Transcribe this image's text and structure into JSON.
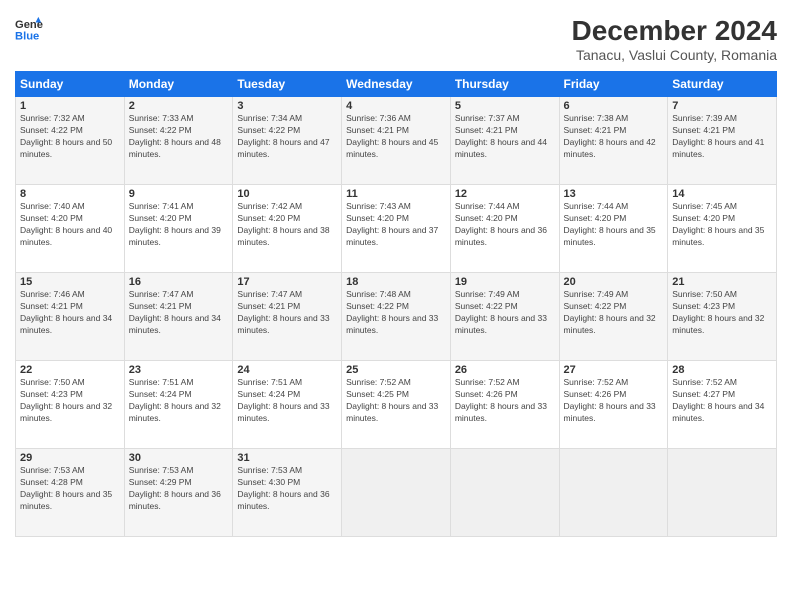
{
  "header": {
    "logo_line1": "General",
    "logo_line2": "Blue",
    "title": "December 2024",
    "subtitle": "Tanacu, Vaslui County, Romania"
  },
  "days_of_week": [
    "Sunday",
    "Monday",
    "Tuesday",
    "Wednesday",
    "Thursday",
    "Friday",
    "Saturday"
  ],
  "weeks": [
    [
      {
        "day": "1",
        "sunrise": "7:32 AM",
        "sunset": "4:22 PM",
        "daylight": "8 hours and 50 minutes."
      },
      {
        "day": "2",
        "sunrise": "7:33 AM",
        "sunset": "4:22 PM",
        "daylight": "8 hours and 48 minutes."
      },
      {
        "day": "3",
        "sunrise": "7:34 AM",
        "sunset": "4:22 PM",
        "daylight": "8 hours and 47 minutes."
      },
      {
        "day": "4",
        "sunrise": "7:36 AM",
        "sunset": "4:21 PM",
        "daylight": "8 hours and 45 minutes."
      },
      {
        "day": "5",
        "sunrise": "7:37 AM",
        "sunset": "4:21 PM",
        "daylight": "8 hours and 44 minutes."
      },
      {
        "day": "6",
        "sunrise": "7:38 AM",
        "sunset": "4:21 PM",
        "daylight": "8 hours and 42 minutes."
      },
      {
        "day": "7",
        "sunrise": "7:39 AM",
        "sunset": "4:21 PM",
        "daylight": "8 hours and 41 minutes."
      }
    ],
    [
      {
        "day": "8",
        "sunrise": "7:40 AM",
        "sunset": "4:20 PM",
        "daylight": "8 hours and 40 minutes."
      },
      {
        "day": "9",
        "sunrise": "7:41 AM",
        "sunset": "4:20 PM",
        "daylight": "8 hours and 39 minutes."
      },
      {
        "day": "10",
        "sunrise": "7:42 AM",
        "sunset": "4:20 PM",
        "daylight": "8 hours and 38 minutes."
      },
      {
        "day": "11",
        "sunrise": "7:43 AM",
        "sunset": "4:20 PM",
        "daylight": "8 hours and 37 minutes."
      },
      {
        "day": "12",
        "sunrise": "7:44 AM",
        "sunset": "4:20 PM",
        "daylight": "8 hours and 36 minutes."
      },
      {
        "day": "13",
        "sunrise": "7:44 AM",
        "sunset": "4:20 PM",
        "daylight": "8 hours and 35 minutes."
      },
      {
        "day": "14",
        "sunrise": "7:45 AM",
        "sunset": "4:20 PM",
        "daylight": "8 hours and 35 minutes."
      }
    ],
    [
      {
        "day": "15",
        "sunrise": "7:46 AM",
        "sunset": "4:21 PM",
        "daylight": "8 hours and 34 minutes."
      },
      {
        "day": "16",
        "sunrise": "7:47 AM",
        "sunset": "4:21 PM",
        "daylight": "8 hours and 34 minutes."
      },
      {
        "day": "17",
        "sunrise": "7:47 AM",
        "sunset": "4:21 PM",
        "daylight": "8 hours and 33 minutes."
      },
      {
        "day": "18",
        "sunrise": "7:48 AM",
        "sunset": "4:22 PM",
        "daylight": "8 hours and 33 minutes."
      },
      {
        "day": "19",
        "sunrise": "7:49 AM",
        "sunset": "4:22 PM",
        "daylight": "8 hours and 33 minutes."
      },
      {
        "day": "20",
        "sunrise": "7:49 AM",
        "sunset": "4:22 PM",
        "daylight": "8 hours and 32 minutes."
      },
      {
        "day": "21",
        "sunrise": "7:50 AM",
        "sunset": "4:23 PM",
        "daylight": "8 hours and 32 minutes."
      }
    ],
    [
      {
        "day": "22",
        "sunrise": "7:50 AM",
        "sunset": "4:23 PM",
        "daylight": "8 hours and 32 minutes."
      },
      {
        "day": "23",
        "sunrise": "7:51 AM",
        "sunset": "4:24 PM",
        "daylight": "8 hours and 32 minutes."
      },
      {
        "day": "24",
        "sunrise": "7:51 AM",
        "sunset": "4:24 PM",
        "daylight": "8 hours and 33 minutes."
      },
      {
        "day": "25",
        "sunrise": "7:52 AM",
        "sunset": "4:25 PM",
        "daylight": "8 hours and 33 minutes."
      },
      {
        "day": "26",
        "sunrise": "7:52 AM",
        "sunset": "4:26 PM",
        "daylight": "8 hours and 33 minutes."
      },
      {
        "day": "27",
        "sunrise": "7:52 AM",
        "sunset": "4:26 PM",
        "daylight": "8 hours and 33 minutes."
      },
      {
        "day": "28",
        "sunrise": "7:52 AM",
        "sunset": "4:27 PM",
        "daylight": "8 hours and 34 minutes."
      }
    ],
    [
      {
        "day": "29",
        "sunrise": "7:53 AM",
        "sunset": "4:28 PM",
        "daylight": "8 hours and 35 minutes."
      },
      {
        "day": "30",
        "sunrise": "7:53 AM",
        "sunset": "4:29 PM",
        "daylight": "8 hours and 36 minutes."
      },
      {
        "day": "31",
        "sunrise": "7:53 AM",
        "sunset": "4:30 PM",
        "daylight": "8 hours and 36 minutes."
      },
      null,
      null,
      null,
      null
    ]
  ]
}
